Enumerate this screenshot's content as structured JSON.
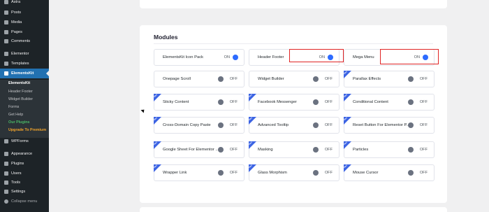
{
  "sidebar": {
    "items": [
      {
        "id": "astra",
        "label": "Astra",
        "icon": "astra-icon"
      },
      {
        "id": "posts",
        "label": "Posts",
        "icon": "pin-icon"
      },
      {
        "id": "media",
        "label": "Media",
        "icon": "media-icon"
      },
      {
        "id": "pages",
        "label": "Pages",
        "icon": "page-icon"
      },
      {
        "id": "comments",
        "label": "Comments",
        "icon": "comment-icon"
      },
      {
        "id": "elementor",
        "label": "Elementor",
        "icon": "elementor-icon"
      },
      {
        "id": "templates",
        "label": "Templates",
        "icon": "folder-icon"
      },
      {
        "id": "elementskit",
        "label": "ElementsKit",
        "icon": "elementskit-icon"
      }
    ],
    "submenu": [
      "ElementsKit",
      "Header Footer",
      "Widget Builder",
      "Forms",
      "Get Help",
      "Our Plugins",
      "Upgrade To Premium"
    ],
    "lower_items": [
      {
        "id": "wpforms",
        "label": "WPForms",
        "icon": "wpforms-icon"
      },
      {
        "id": "appearance",
        "label": "Appearance",
        "icon": "brush-icon"
      },
      {
        "id": "plugins",
        "label": "Plugins",
        "icon": "plugin-icon"
      },
      {
        "id": "users",
        "label": "Users",
        "icon": "user-icon"
      },
      {
        "id": "tools",
        "label": "Tools",
        "icon": "wrench-icon"
      },
      {
        "id": "settings",
        "label": "Settings",
        "icon": "settings-icon"
      },
      {
        "id": "collapse",
        "label": "Collapse menu",
        "icon": "collapse-icon"
      }
    ]
  },
  "modules": {
    "title": "Modules",
    "on_label": "ON",
    "off_label": "OFF",
    "badge_label": "PRO",
    "cards": [
      {
        "label": "ElementsKit Icon Pack",
        "state": "on",
        "pro": false
      },
      {
        "label": "Header Footer",
        "state": "on",
        "pro": false
      },
      {
        "label": "Mega Menu",
        "state": "on",
        "pro": false
      },
      {
        "label": "Onepage Scroll",
        "state": "off",
        "pro": false
      },
      {
        "label": "Widget Builder",
        "state": "off",
        "pro": false
      },
      {
        "label": "Parallax Effects",
        "state": "off",
        "pro": true
      },
      {
        "label": "Sticky Content",
        "state": "off",
        "pro": true
      },
      {
        "label": "Facebook Messenger",
        "state": "off",
        "pro": true
      },
      {
        "label": "Conditional Content",
        "state": "off",
        "pro": true
      },
      {
        "label": "Cross-Domain Copy Paste",
        "state": "off",
        "pro": true
      },
      {
        "label": "Advanced Tooltip",
        "state": "off",
        "pro": true
      },
      {
        "label": "Reset Button For Elementor P...",
        "state": "off",
        "pro": true
      },
      {
        "label": "Google Sheet For Elementor ...",
        "state": "off",
        "pro": true
      },
      {
        "label": "Masking",
        "state": "off",
        "pro": true
      },
      {
        "label": "Particles",
        "state": "off",
        "pro": true
      },
      {
        "label": "Wrapper Link",
        "state": "off",
        "pro": true
      },
      {
        "label": "Glass Morphism",
        "state": "off",
        "pro": true
      },
      {
        "label": "Mouse Cursor",
        "state": "off",
        "pro": true
      }
    ]
  }
}
